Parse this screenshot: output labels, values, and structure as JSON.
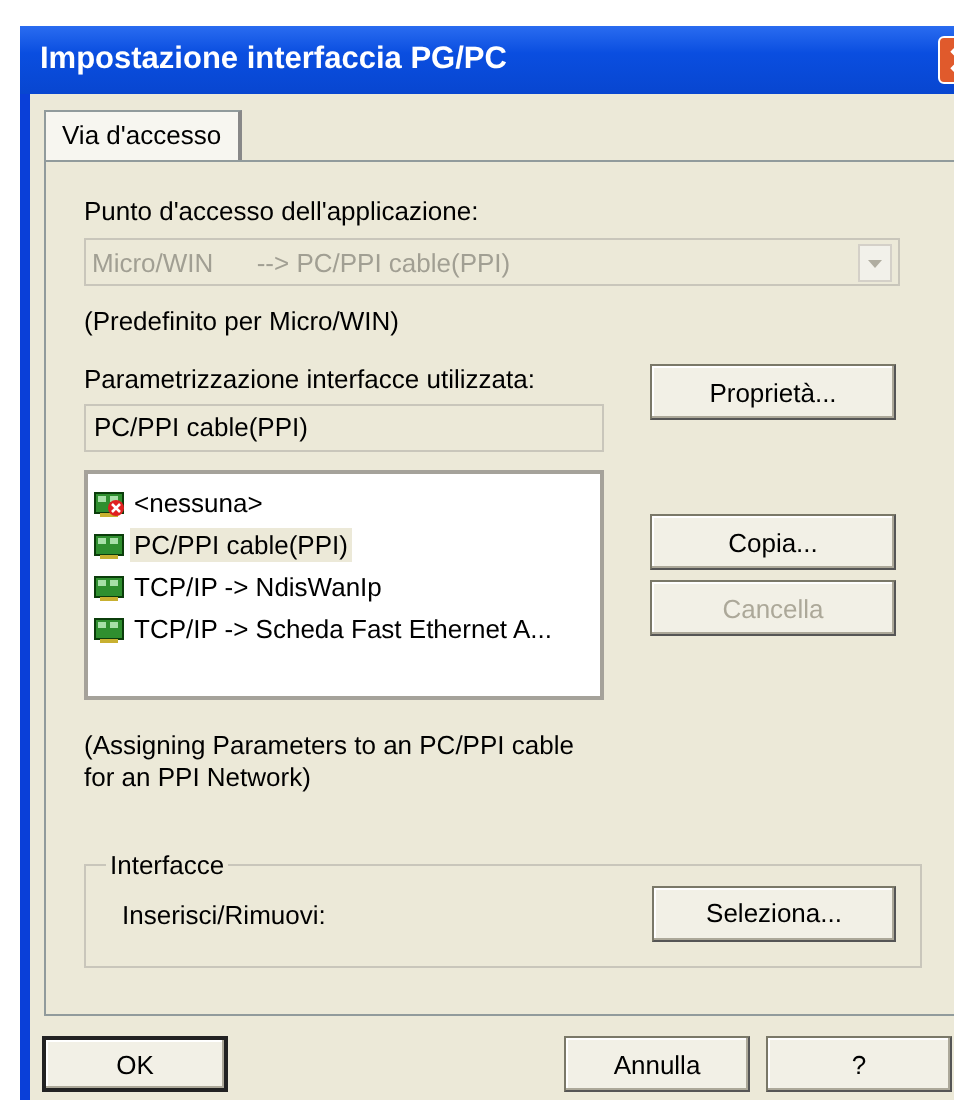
{
  "window": {
    "title": "Impostazione interfaccia PG/PC"
  },
  "tabs": [
    {
      "label": "Via d'accesso",
      "selected": true
    }
  ],
  "access_point": {
    "label": "Punto d'accesso dell'applicazione:",
    "value": "Micro/WIN      --> PC/PPI cable(PPI)",
    "disabled": true,
    "note": "(Predefinito per Micro/WIN)"
  },
  "interface": {
    "label": "Parametrizzazione interfacce utilizzata:",
    "value": "PC/PPI cable(PPI)"
  },
  "interfaces": [
    {
      "label": "<nessuna>",
      "kind": "none",
      "selected": false
    },
    {
      "label": "PC/PPI cable(PPI)",
      "kind": "card",
      "selected": true
    },
    {
      "label": "TCP/IP -> NdisWanIp",
      "kind": "card",
      "selected": false
    },
    {
      "label": "TCP/IP -> Scheda Fast Ethernet A...",
      "kind": "card",
      "selected": false
    }
  ],
  "side_buttons": [
    {
      "label": "Proprietà...",
      "disabled": false
    },
    {
      "label": "Copia...",
      "disabled": false
    },
    {
      "label": "Cancella",
      "disabled": true
    }
  ],
  "description": "(Assigning Parameters to an PC/PPI cable\nfor an PPI Network)",
  "group": {
    "title": "Interfacce",
    "label": "Inserisci/Rimuovi:",
    "button": "Seleziona..."
  },
  "footer_buttons": [
    {
      "label": "OK",
      "default": true
    },
    {
      "label": "Annulla",
      "default": false
    },
    {
      "label": "?",
      "default": false
    }
  ]
}
